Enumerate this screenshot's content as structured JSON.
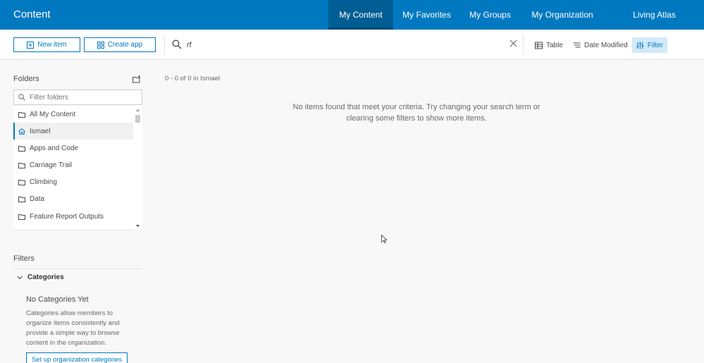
{
  "header": {
    "title": "Content",
    "tabs": [
      {
        "label": "My Content",
        "active": true
      },
      {
        "label": "My Favorites",
        "active": false
      },
      {
        "label": "My Groups",
        "active": false
      },
      {
        "label": "My Organization",
        "active": false
      },
      {
        "label": "Living Atlas",
        "active": false
      }
    ]
  },
  "toolbar": {
    "new_item_label": "New item",
    "create_app_label": "Create app",
    "search_value": "rf",
    "table_label": "Table",
    "sort_label": "Date Modified",
    "filter_label": "Filter"
  },
  "sidebar": {
    "folders_heading": "Folders",
    "filter_placeholder": "Filter folders",
    "folders": [
      {
        "label": "All My Content",
        "icon": "folder-icon",
        "selected": false
      },
      {
        "label": "Ismael",
        "icon": "home-icon",
        "selected": true
      },
      {
        "label": "Apps and Code",
        "icon": "folder-icon",
        "selected": false
      },
      {
        "label": "Carriage Trail",
        "icon": "folder-icon",
        "selected": false
      },
      {
        "label": "Climbing",
        "icon": "folder-icon",
        "selected": false
      },
      {
        "label": "Data",
        "icon": "folder-icon",
        "selected": false
      },
      {
        "label": "Feature Report Outputs",
        "icon": "folder-icon",
        "selected": false
      }
    ],
    "filters_heading": "Filters",
    "categories_label": "Categories",
    "no_categories_title": "No Categories Yet",
    "no_categories_desc": "Categories allow members to organize items consistently and provide a simple way to browse content in the organization.",
    "setup_button_label": "Set up organization categories"
  },
  "main": {
    "result_count": "0 - 0 of 0 in Ismael",
    "empty_message": "No items found that meet your criteria. Try changing your search term or clearing some filters to show more items."
  },
  "colors": {
    "brand": "#0079c1",
    "active_tab": "#005e95"
  }
}
